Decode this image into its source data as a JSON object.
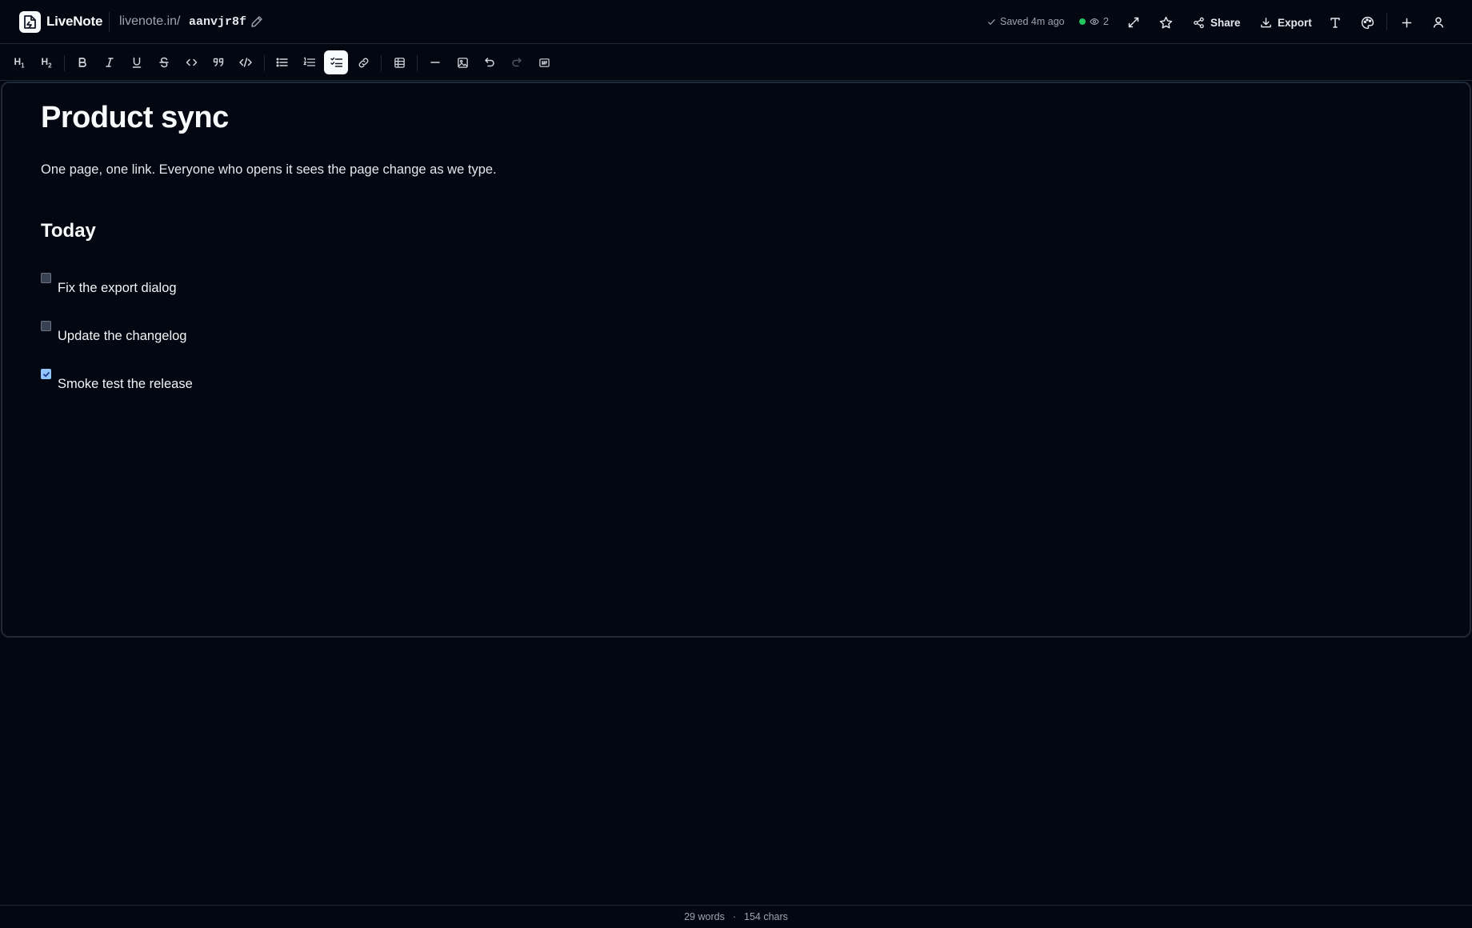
{
  "app": {
    "name": "LiveNote"
  },
  "header": {
    "url_prefix": "livenote.in/",
    "url_slug": "aanvjr8f",
    "save_status": "Saved 4m ago",
    "viewer_count": "2",
    "share_label": "Share",
    "export_label": "Export",
    "icons": [
      "expand-icon",
      "star-icon",
      "share-icon",
      "download-icon",
      "text-size-icon",
      "palette-icon",
      "plus-icon",
      "user-icon"
    ]
  },
  "toolbar": {
    "h1_label": "H",
    "h1_sub": "1",
    "h2_label": "H",
    "h2_sub": "2",
    "active_tool": "task-list",
    "tools": [
      "heading-1",
      "heading-2",
      "bold",
      "italic",
      "underline",
      "strikethrough",
      "inline-code",
      "blockquote",
      "code-block",
      "bullet-list",
      "ordered-list",
      "task-list",
      "link",
      "table",
      "horizontal-rule",
      "image",
      "undo",
      "redo",
      "gif"
    ]
  },
  "document": {
    "title": "Product sync",
    "paragraph": "One page, one link. Everyone who opens it sees the page change as we type.",
    "section_heading": "Today",
    "tasks": [
      {
        "label": "Fix the export dialog",
        "checked": false
      },
      {
        "label": "Update the changelog",
        "checked": false
      },
      {
        "label": "Smoke test the release",
        "checked": true
      }
    ]
  },
  "footer": {
    "words": "29 words",
    "separator": "·",
    "chars": "154 chars"
  },
  "colors": {
    "background": "#030712",
    "border": "#1f2937",
    "online_dot": "#22c55e",
    "checkbox_checked": "#93c5fd"
  }
}
